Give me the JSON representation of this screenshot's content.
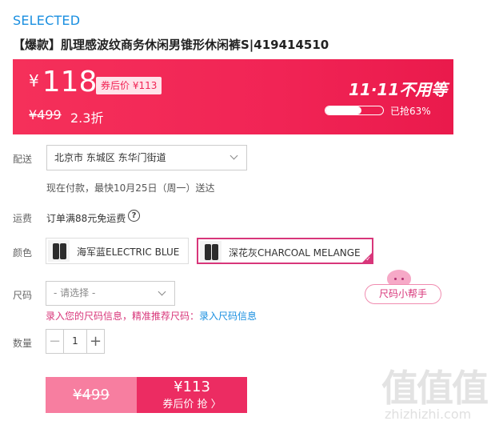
{
  "header": {
    "brand": "SELECTED",
    "title": "【爆款】肌理感波纹商务休闲男锥形休闲裤S|419414510"
  },
  "price": {
    "currency": "¥",
    "current": "118",
    "coupon_price": "券后价 ¥113",
    "original": "¥499",
    "discount": "2.3折",
    "promo_title": "11·11不用等",
    "sold_percent": 63,
    "sold_text": "已抢63%"
  },
  "delivery": {
    "label": "配送",
    "address": "北京市 东城区 东华门街道",
    "note": "现在付款，最快10月25日（周一）送达"
  },
  "shipping": {
    "label": "运费",
    "text": "订单满88元免运费",
    "help_icon": "?"
  },
  "color": {
    "label": "颜色",
    "options": [
      {
        "label": "海军蓝ELECTRIC BLUE",
        "selected": false
      },
      {
        "label": "深花灰CHARCOAL MELANGE",
        "selected": true
      }
    ]
  },
  "size": {
    "label": "尺码",
    "placeholder": "- 请选择 -",
    "note": "录入您的尺码信息，精准推荐尺码：",
    "note_link": "录入尺码信息",
    "helper": "尺码小帮手"
  },
  "quantity": {
    "label": "数量",
    "minus": "−",
    "value": "1",
    "plus": "+"
  },
  "buy": {
    "left_price": "¥499",
    "right_price": "¥113",
    "right_sub": "券后价 抢 〉"
  },
  "watermark": {
    "big": "值值值",
    "small": "zhizhizhi.com"
  },
  "colors": {
    "accent_pink": "#ec2c62",
    "brand_blue": "#1a8fe0",
    "selected_border": "#d8367a"
  }
}
